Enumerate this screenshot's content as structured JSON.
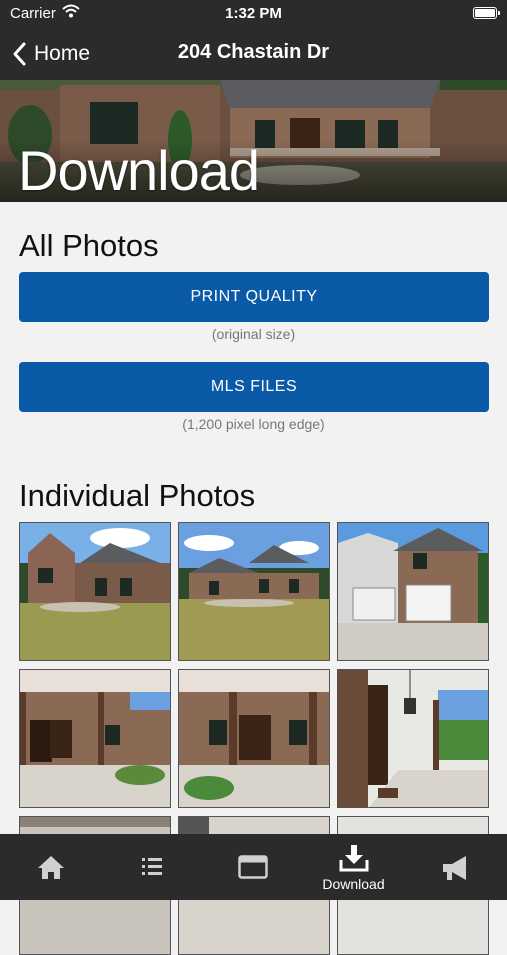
{
  "status_bar": {
    "carrier": "Carrier",
    "time": "1:32 PM"
  },
  "nav": {
    "back_label": "Home",
    "title": "204 Chastain Dr"
  },
  "hero": {
    "title": "Download"
  },
  "all_photos": {
    "heading": "All Photos",
    "print_button": "PRINT QUALITY",
    "print_caption": "(original size)",
    "mls_button": "MLS FILES",
    "mls_caption": "(1,200 pixel long edge)"
  },
  "individual": {
    "heading": "Individual Photos"
  },
  "tabs": [
    {
      "icon": "home-icon",
      "label": ""
    },
    {
      "icon": "list-icon",
      "label": ""
    },
    {
      "icon": "browser-icon",
      "label": ""
    },
    {
      "icon": "download-icon",
      "label": "Download"
    },
    {
      "icon": "megaphone-icon",
      "label": ""
    }
  ],
  "colors": {
    "bar_bg": "#2b2b2b",
    "button_blue": "#0a5aa8",
    "page_bg": "#f2f2f2"
  }
}
